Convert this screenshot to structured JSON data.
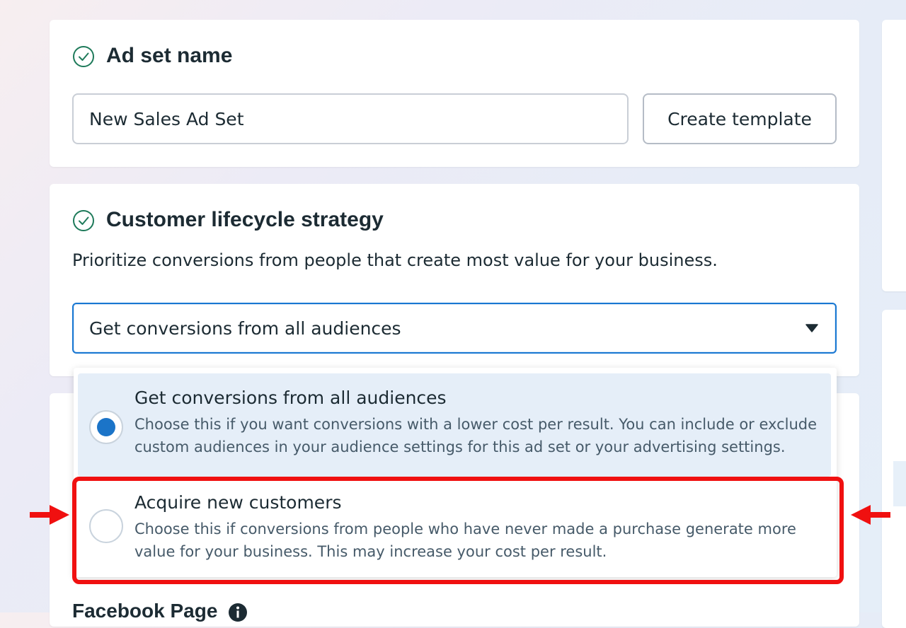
{
  "ad_set_name_section": {
    "title": "Ad set name",
    "input_value": "New Sales Ad Set",
    "create_template_label": "Create template"
  },
  "lifecycle_section": {
    "title": "Customer lifecycle strategy",
    "description": "Prioritize conversions from people that create most value for your business.",
    "selected_value": "Get conversions from all audiences",
    "options": [
      {
        "title": "Get conversions from all audiences",
        "description": "Choose this if you want conversions with a lower cost per result. You can include or exclude custom audiences in your audience settings for this ad set or your advertising settings.",
        "selected": true
      },
      {
        "title": "Acquire new customers",
        "description": "Choose this if conversions from people who have never made a purchase generate more value for your business. This may increase your cost per result.",
        "selected": false
      }
    ]
  },
  "facebook_page_section": {
    "title": "Facebook Page"
  },
  "icons": {
    "section_status": "check-circle-icon",
    "dropdown": "caret-down-icon",
    "info": "info-icon",
    "annotation": "red-arrow-icon"
  },
  "colors": {
    "accent_blue": "#1877d2",
    "selected_option_bg": "#e5eef8",
    "success_green": "#1e7a5a",
    "annotation_red": "#f01010"
  }
}
